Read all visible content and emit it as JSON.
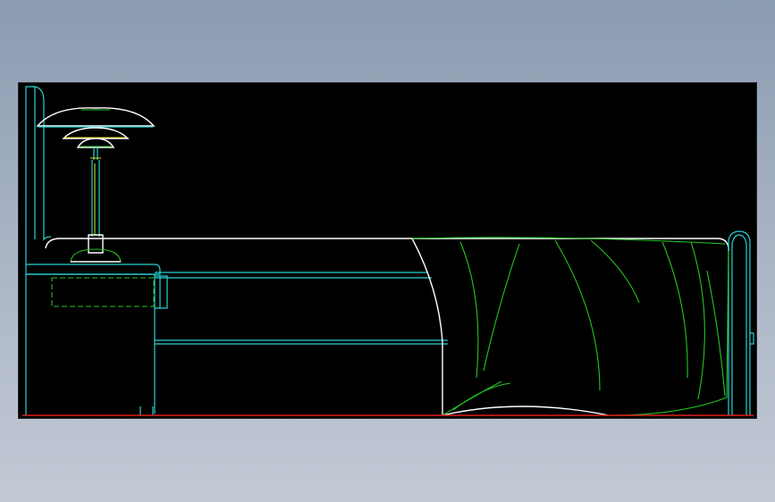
{
  "drawing": {
    "description_visible_text": "",
    "colors": {
      "background_outer": "#a6b2c3",
      "viewport": "#000000",
      "cyan": "#27d3d3",
      "white": "#ffffff",
      "green": "#22c622",
      "red": "#e01f1f",
      "yellow": "#d8d81e"
    }
  }
}
